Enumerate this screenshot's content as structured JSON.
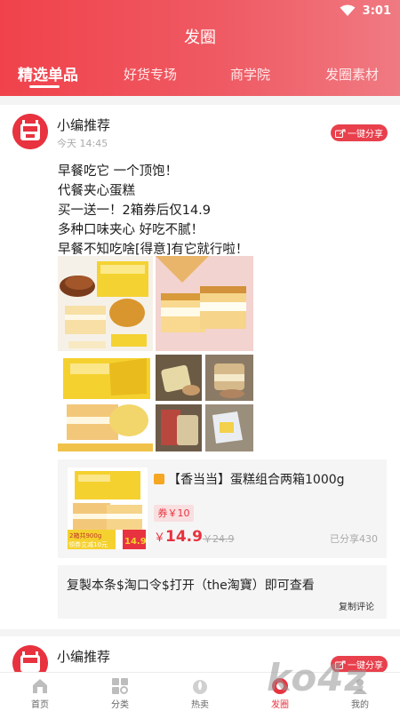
{
  "status_bar": {
    "time": "3:01"
  },
  "header": {
    "title": "发圈"
  },
  "tabs": [
    {
      "label": "精选单品",
      "active": true
    },
    {
      "label": "好货专场",
      "active": false
    },
    {
      "label": "商学院",
      "active": false
    },
    {
      "label": "发圈素材",
      "active": false
    }
  ],
  "post": {
    "author": "小编推荐",
    "time": "今天 14:45",
    "share_label": "一键分享",
    "lines": [
      "早餐吃它    一个顶饱！",
      "     代餐夹心蛋糕",
      "买一送一！2箱券后仅14.9",
      "多种口味夹心    好吃不腻！",
      "早餐不知吃啥[得意]有它就行啦！"
    ],
    "product": {
      "title": "【香当当】蛋糕组合两箱1000g",
      "coupon": "券￥10",
      "price_symbol": "￥",
      "price": "14.9",
      "original_price": "￥24.9",
      "shared": "已分享430",
      "image_text_box": "2箱共900g",
      "image_text_coupon": "领券立减10元",
      "image_text_price": "14.9"
    },
    "copy_text": "复製本条$淘口令$打开（the淘寶）即可查看",
    "copy_button": "复制评论"
  },
  "post2": {
    "author": "小编推荐",
    "share_label": "一键分享"
  },
  "bottom_nav": [
    {
      "label": "首页",
      "icon": "home-icon",
      "active": false
    },
    {
      "label": "分类",
      "icon": "category-icon",
      "active": false
    },
    {
      "label": "热卖",
      "icon": "hot-icon",
      "active": false
    },
    {
      "label": "发圈",
      "icon": "moments-icon",
      "active": true
    },
    {
      "label": "我的",
      "icon": "profile-icon",
      "active": false
    }
  ],
  "watermark": "ko4z",
  "colors": {
    "brand": "#e8323f",
    "header_start": "#f0424b",
    "header_end": "#f07a82"
  }
}
